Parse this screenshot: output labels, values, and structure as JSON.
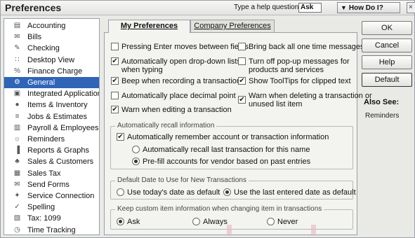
{
  "window": {
    "title": "Preferences",
    "help_label": "Type a help question",
    "help_button": "Ask",
    "howdoi": "How Do I?",
    "close_glyph": "×"
  },
  "sidebar": {
    "items": [
      {
        "label": "Accounting",
        "icon": "accounting-icon",
        "glyph": "▤",
        "selected": false
      },
      {
        "label": "Bills",
        "icon": "bills-icon",
        "glyph": "✉",
        "selected": false
      },
      {
        "label": "Checking",
        "icon": "checking-icon",
        "glyph": "✎",
        "selected": false
      },
      {
        "label": "Desktop View",
        "icon": "desktop-view-icon",
        "glyph": "∷",
        "selected": false
      },
      {
        "label": "Finance Charge",
        "icon": "finance-charge-icon",
        "glyph": "%",
        "selected": false
      },
      {
        "label": "General",
        "icon": "general-icon",
        "glyph": "⚙",
        "selected": true
      },
      {
        "label": "Integrated Applications",
        "icon": "integrated-applications-icon",
        "glyph": "▣",
        "selected": false
      },
      {
        "label": "Items & Inventory",
        "icon": "items-inventory-icon",
        "glyph": "●",
        "selected": false
      },
      {
        "label": "Jobs & Estimates",
        "icon": "jobs-estimates-icon",
        "glyph": "≡",
        "selected": false
      },
      {
        "label": "Payroll & Employees",
        "icon": "payroll-employees-icon",
        "glyph": "▥",
        "selected": false
      },
      {
        "label": "Reminders",
        "icon": "reminders-icon",
        "glyph": "☼",
        "selected": false
      },
      {
        "label": "Reports & Graphs",
        "icon": "reports-graphs-icon",
        "glyph": "▐",
        "selected": false
      },
      {
        "label": "Sales & Customers",
        "icon": "sales-customers-icon",
        "glyph": "♣",
        "selected": false
      },
      {
        "label": "Sales Tax",
        "icon": "sales-tax-icon",
        "glyph": "▦",
        "selected": false
      },
      {
        "label": "Send Forms",
        "icon": "send-forms-icon",
        "glyph": "✉",
        "selected": false
      },
      {
        "label": "Service Connection",
        "icon": "service-connection-icon",
        "glyph": "✦",
        "selected": false
      },
      {
        "label": "Spelling",
        "icon": "spelling-icon",
        "glyph": "✓",
        "selected": false
      },
      {
        "label": "Tax: 1099",
        "icon": "tax-1099-icon",
        "glyph": "▧",
        "selected": false
      },
      {
        "label": "Time Tracking",
        "icon": "time-tracking-icon",
        "glyph": "◷",
        "selected": false
      }
    ]
  },
  "tabs": [
    {
      "label": "My Preferences",
      "active": true
    },
    {
      "label": "Company Preferences",
      "active": false
    }
  ],
  "options": {
    "pressing_enter": {
      "label": "Pressing Enter moves between fields",
      "checked": false
    },
    "bring_back": {
      "label": "Bring back all one time messages",
      "checked": false
    },
    "auto_open": {
      "label": "Automatically open drop-down lists",
      "label2": "when typing",
      "checked": true
    },
    "turn_off_popup": {
      "label": "Turn off pop-up messages for",
      "label2": "products and services",
      "checked": false
    },
    "beep": {
      "label": "Beep when recording a transaction",
      "checked": true
    },
    "show_tooltips": {
      "label": "Show ToolTips for clipped text",
      "checked": true
    },
    "decimal": {
      "label": "Automatically place decimal point",
      "checked": false
    },
    "warn_deleting": {
      "label": "Warn when deleting a transaction or",
      "label2": "unused list item",
      "checked": true
    },
    "warn_editing": {
      "label": "Warn when editing a transaction",
      "checked": true
    }
  },
  "recall_group": {
    "legend": "Automatically recall information",
    "remember": {
      "label": "Automatically remember account or transaction information",
      "checked": true
    },
    "radio_last": {
      "label": "Automatically recall last transaction for this name",
      "selected": false
    },
    "radio_prefill": {
      "label": "Pre-fill accounts for vendor based on past entries",
      "selected": true
    }
  },
  "date_group": {
    "legend": "Default Date to Use for New Transactions",
    "today": {
      "label": "Use today's date as default",
      "selected": false
    },
    "last": {
      "label": "Use the last entered date as default",
      "selected": true
    }
  },
  "custom_group": {
    "legend": "Keep custom item information when changing item in transactions",
    "ask": {
      "label": "Ask",
      "selected": true
    },
    "always": {
      "label": "Always",
      "selected": false
    },
    "never": {
      "label": "Never",
      "selected": false
    }
  },
  "buttons": {
    "ok": "OK",
    "cancel": "Cancel",
    "help": "Help",
    "default": "Default"
  },
  "also_see": {
    "title": "Also See:",
    "link": "Reminders"
  }
}
